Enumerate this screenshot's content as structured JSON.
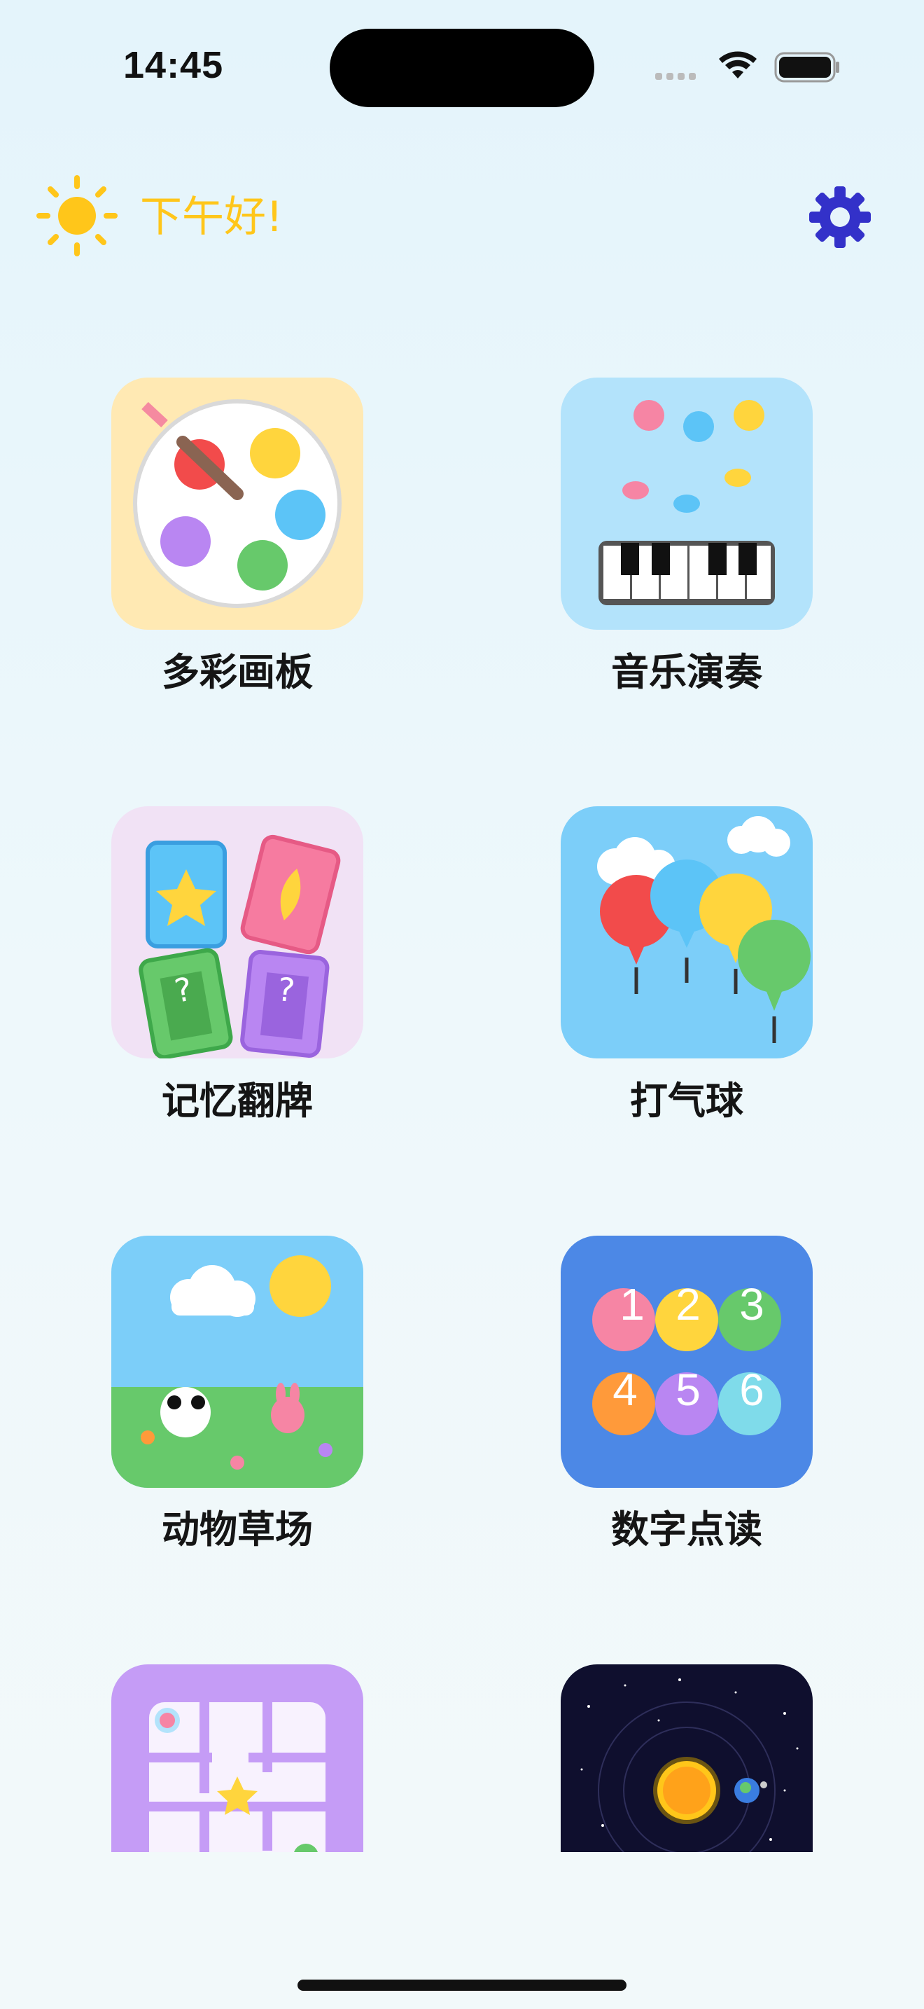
{
  "status_bar": {
    "time": "14:45"
  },
  "header": {
    "greeting": "下午好!",
    "greeting_icon": "sun-icon",
    "settings_icon": "gear-icon",
    "accent_color": "#ffc61a",
    "settings_color": "#3331c9"
  },
  "games": [
    {
      "label": "多彩画板",
      "icon": "palette-icon"
    },
    {
      "label": "音乐演奏",
      "icon": "piano-icon"
    },
    {
      "label": "记忆翻牌",
      "icon": "cards-icon"
    },
    {
      "label": "打气球",
      "icon": "balloons-icon"
    },
    {
      "label": "动物草场",
      "icon": "meadow-icon"
    },
    {
      "label": "数字点读",
      "icon": "numbers-icon",
      "digits": [
        "1",
        "2",
        "3",
        "4",
        "5",
        "6"
      ]
    },
    {
      "label": "",
      "icon": "maze-icon"
    },
    {
      "label": "",
      "icon": "solar-system-icon"
    }
  ]
}
